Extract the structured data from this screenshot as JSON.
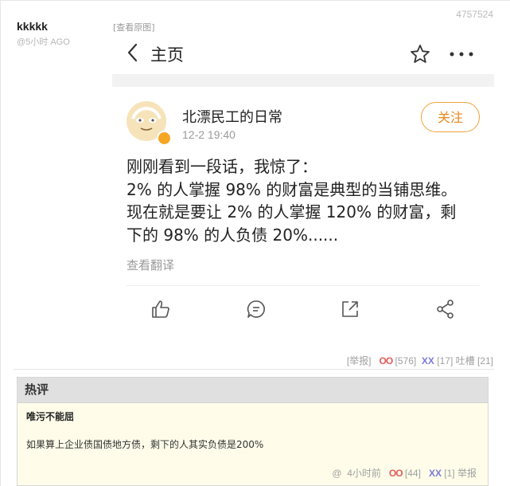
{
  "post": {
    "id": "4757524",
    "author": "kkkkk",
    "time": "@5小时 AGO",
    "view_original": "[查看原图]"
  },
  "screenshot": {
    "header_title": "主页",
    "user_name": "北漂民工的日常",
    "date": "12-2 19:40",
    "follow_label": "关注",
    "body_lines": [
      "刚刚看到一段话，我惊了：",
      "2% 的人掌握 98% 的财富是典型的当铺思维。",
      "现在就是要让 2% 的人掌握 120% 的财富，剩",
      "下的 98% 的人负债 20%......"
    ],
    "translate_label": "查看翻译",
    "icons": [
      "back-icon",
      "star-icon",
      "more-icon",
      "like-icon",
      "comment-icon",
      "share-icon",
      "forward-icon"
    ]
  },
  "actions": {
    "report": "[举报]",
    "oo_label": "OO",
    "oo_count": "[576]",
    "xx_label": "XX",
    "xx_count": "[17]",
    "tucao": "吐槽",
    "tucao_count": "[21]"
  },
  "hot_comments": {
    "header": "热评",
    "author": "唯污不能屈",
    "text": "如果算上企业债国债地方债，剩下的人其实负债是200%",
    "at": "@",
    "time": "4小时前",
    "oo_label": "OO",
    "oo_count": "[44]",
    "xx_label": "XX",
    "xx_count": "[1]",
    "report": "举报"
  },
  "colors": {
    "oo": "#e55a5a",
    "xx": "#7b7bd9",
    "follow": "#e8891a",
    "hot_bg": "#fffdea"
  }
}
